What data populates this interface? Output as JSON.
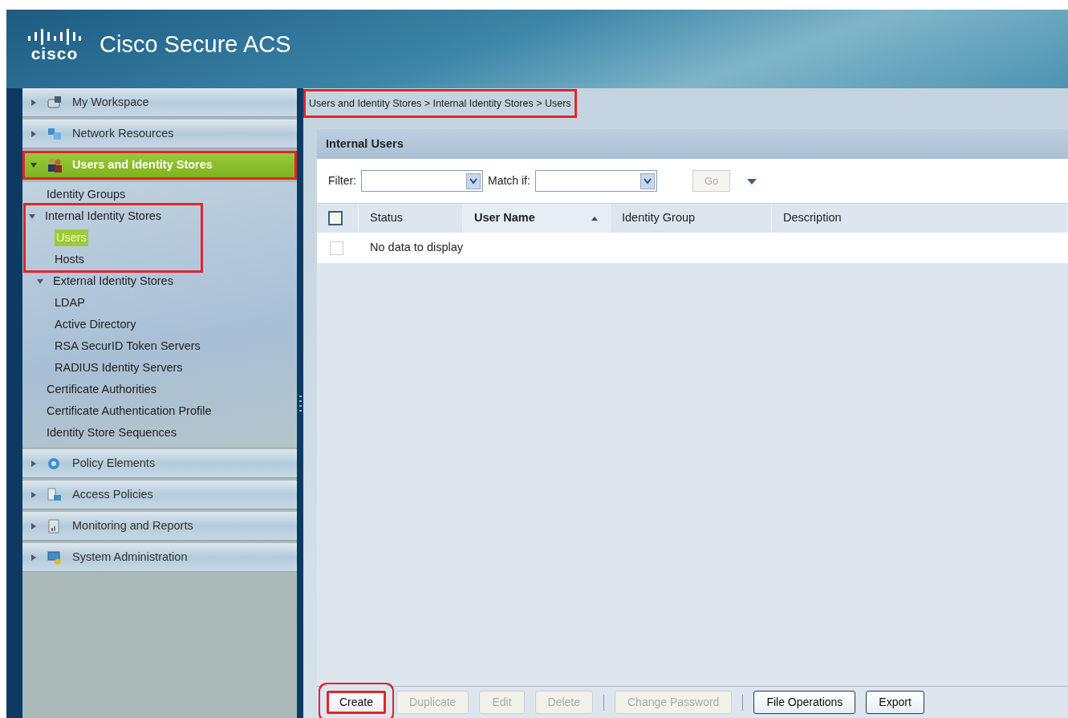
{
  "header": {
    "logo_text": "cisco",
    "title": "Cisco Secure ACS"
  },
  "sidebar": {
    "sections": [
      {
        "label": "My Workspace",
        "expanded": false,
        "selected": false,
        "highlighted": false
      },
      {
        "label": "Network Resources",
        "expanded": false,
        "selected": false,
        "highlighted": false
      },
      {
        "label": "Users and Identity Stores",
        "expanded": true,
        "selected": true,
        "highlighted": true,
        "children": [
          {
            "label": "Identity Groups",
            "selected": false
          },
          {
            "label": "Internal Identity Stores",
            "selected": false,
            "expanded": true,
            "highlighted": true,
            "children": [
              {
                "label": "Users",
                "selected": true
              },
              {
                "label": "Hosts",
                "selected": false
              }
            ]
          },
          {
            "label": "External Identity Stores",
            "selected": false,
            "expanded": true,
            "children": [
              {
                "label": "LDAP",
                "selected": false
              },
              {
                "label": "Active Directory",
                "selected": false
              },
              {
                "label": "RSA SecurID Token Servers",
                "selected": false
              },
              {
                "label": "RADIUS Identity Servers",
                "selected": false
              }
            ]
          },
          {
            "label": "Certificate Authorities",
            "selected": false
          },
          {
            "label": "Certificate Authentication Profile",
            "selected": false
          },
          {
            "label": "Identity Store Sequences",
            "selected": false
          }
        ]
      },
      {
        "label": "Policy Elements",
        "expanded": false,
        "selected": false,
        "highlighted": false
      },
      {
        "label": "Access Policies",
        "expanded": false,
        "selected": false,
        "highlighted": false
      },
      {
        "label": "Monitoring and Reports",
        "expanded": false,
        "selected": false,
        "highlighted": false
      },
      {
        "label": "System Administration",
        "expanded": false,
        "selected": false,
        "highlighted": false
      }
    ]
  },
  "breadcrumb": {
    "text": "Users and Identity Stores > Internal Identity Stores > Users",
    "highlighted": true
  },
  "panel": {
    "title": "Internal Users",
    "filter": {
      "label": "Filter:",
      "match_label": "Match if:",
      "go": {
        "label": "Go",
        "disabled": true
      }
    },
    "table": {
      "select_all_checked": false,
      "columns": [
        {
          "label": "Status",
          "sorted": false
        },
        {
          "label": "User Name",
          "sorted": true
        },
        {
          "label": "Identity Group",
          "sorted": false
        },
        {
          "label": "Description",
          "sorted": false
        }
      ],
      "empty_text": "No data to display",
      "empty_checked": false
    },
    "buttons": [
      {
        "kind": "button",
        "label": "Create",
        "disabled": false,
        "highlighted": true
      },
      {
        "kind": "button",
        "label": "Duplicate",
        "disabled": true,
        "highlighted": false
      },
      {
        "kind": "button",
        "label": "Edit",
        "disabled": true,
        "highlighted": false
      },
      {
        "kind": "button",
        "label": "Delete",
        "disabled": true,
        "highlighted": false
      },
      {
        "kind": "separator"
      },
      {
        "kind": "button",
        "label": "Change Password",
        "disabled": true,
        "highlighted": false
      },
      {
        "kind": "separator"
      },
      {
        "kind": "button",
        "label": "File Operations",
        "disabled": false,
        "highlighted": false
      },
      {
        "kind": "button",
        "label": "Export",
        "disabled": false,
        "highlighted": false
      }
    ]
  }
}
